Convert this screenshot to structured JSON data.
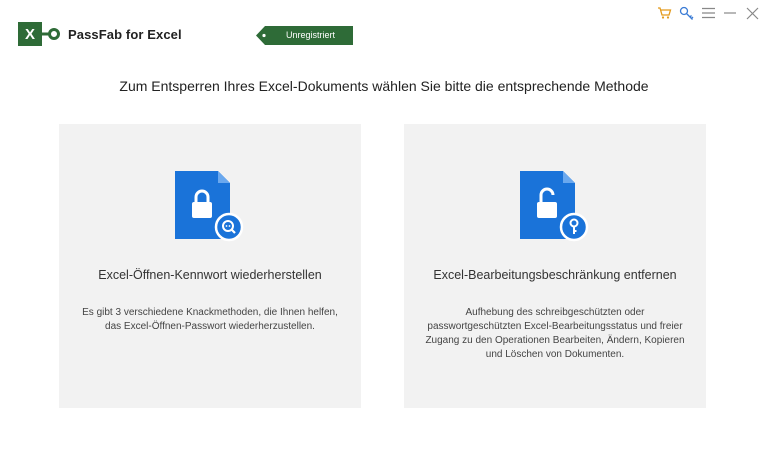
{
  "app": {
    "logo_letter": "X",
    "name": "PassFab for Excel",
    "badge": "Unregistriert",
    "brand_color": "#2e6b37",
    "accent_color": "#1a73d9"
  },
  "window_controls": [
    {
      "icon": "cart-icon"
    },
    {
      "icon": "key-icon"
    },
    {
      "icon": "menu-icon"
    },
    {
      "icon": "minimize-icon"
    },
    {
      "icon": "close-icon"
    }
  ],
  "headline": "Zum Entsperren Ihres Excel-Dokuments wählen Sie bitte die entsprechende Methode",
  "cards": [
    {
      "icon": "locked-document-search-icon",
      "title": "Excel-Öffnen-Kennwort wiederherstellen",
      "description": "Es gibt 3 verschiedene Knackmethoden, die Ihnen helfen, das Excel-Öffnen-Passwort wiederherzustellen."
    },
    {
      "icon": "unlocked-document-key-icon",
      "title": "Excel-Bearbeitungsbeschränkung entfernen",
      "description": "Aufhebung des schreibgeschützten oder passwortgeschützten Excel-Bearbeitungsstatus und freier Zugang zu den Operationen Bearbeiten, Ändern, Kopieren und Löschen von Dokumenten."
    }
  ]
}
